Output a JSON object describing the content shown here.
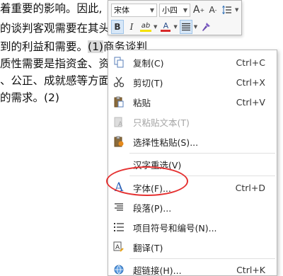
{
  "document": {
    "line1": "着重要的影响。因此,",
    "line2": "的谈判客观需要在其头",
    "line3_pre": "到的利益和需要。",
    "line3_sel": "(1)",
    "line3_post": "商务谈判",
    "line4": "质性需要是指资金、资",
    "line5": "、公正、成就感等方面",
    "line6": "的需求。(2)"
  },
  "mini_toolbar": {
    "font_name": "宋体",
    "font_size": "小四",
    "grow_font": "A",
    "shrink_font": "A",
    "bold": "B",
    "italic": "I",
    "highlight": "ab",
    "font_color": "A"
  },
  "context_menu": {
    "items": [
      {
        "label": "复制(C)",
        "shortcut": "Ctrl+C",
        "icon": "copy-icon"
      },
      {
        "label": "剪切(T)",
        "shortcut": "Ctrl+X",
        "icon": "scissors-icon"
      },
      {
        "label": "粘贴",
        "shortcut": "Ctrl+V",
        "icon": "paste-icon"
      },
      {
        "label": "只粘贴文本(T)",
        "shortcut": "",
        "icon": "paste-text-icon",
        "disabled": true
      },
      {
        "label": "选择性粘贴(S)...",
        "shortcut": "",
        "icon": "paste-special-icon"
      },
      {
        "label": "汉字重选(V)",
        "shortcut": "",
        "icon": ""
      },
      {
        "label": "字体(F)...",
        "shortcut": "Ctrl+D",
        "icon": "font-icon"
      },
      {
        "label": "段落(P)...",
        "shortcut": "",
        "icon": "paragraph-icon"
      },
      {
        "label": "项目符号和编号(N)...",
        "shortcut": "",
        "icon": "bullets-icon"
      },
      {
        "label": "翻译(T)",
        "shortcut": "",
        "icon": "translate-icon"
      },
      {
        "label": "超链接(H)...",
        "shortcut": "Ctrl+K",
        "icon": "hyperlink-icon"
      }
    ]
  },
  "colors": {
    "highlight_color": "#f5e100",
    "font_color": "#d82a2a",
    "annotation": "#e53131",
    "selection": "#d9d9d9"
  }
}
